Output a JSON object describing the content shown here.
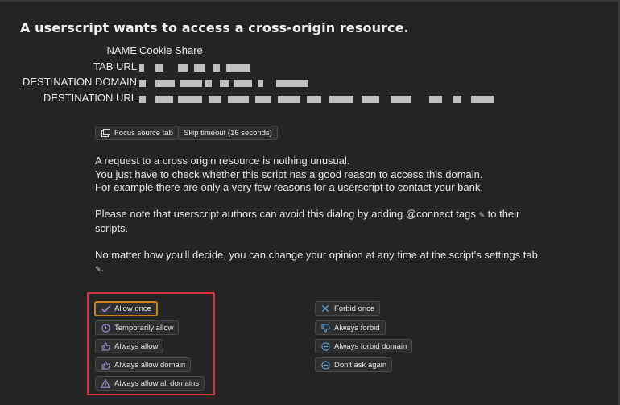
{
  "title": "A userscript wants to access a cross-origin resource.",
  "info": {
    "name_label": "NAME",
    "name_value": "Cookie Share",
    "tab_url_label": "TAB URL",
    "destination_domain_label": "DESTINATION DOMAIN",
    "destination_url_label": "DESTINATION URL"
  },
  "actions": {
    "focus_source_tab": "Focus source tab",
    "skip_timeout": "Skip timeout (16 seconds)"
  },
  "message": {
    "line1": "A request to a cross origin resource is nothing unusual.",
    "line2": "You just have to check whether this script has a good reason to access this domain.",
    "line3": "For example there are only a very few reasons for a userscript to contact your bank.",
    "line4a": "Please note that userscript authors can avoid this dialog by adding @connect tags",
    "line4b": "to their",
    "line5": "scripts.",
    "line6": "No matter how you'll decide, you can change your opinion at any time at the script's settings tab",
    "line7": "."
  },
  "allow_buttons": {
    "allow_once": "Allow once",
    "temporarily_allow": "Temporarily allow",
    "always_allow": "Always allow",
    "always_allow_domain": "Always allow domain",
    "always_allow_all_domains": "Always allow all domains"
  },
  "forbid_buttons": {
    "forbid_once": "Forbid once",
    "always_forbid": "Always forbid",
    "always_forbid_domain": "Always forbid domain",
    "dont_ask_again": "Don't ask again"
  },
  "colors": {
    "background": "#242424",
    "primary_outline": "#c9821e",
    "highlight_box": "#d6323c",
    "allow_icon": "#a98de0",
    "forbid_icon": "#5aa9e6"
  }
}
